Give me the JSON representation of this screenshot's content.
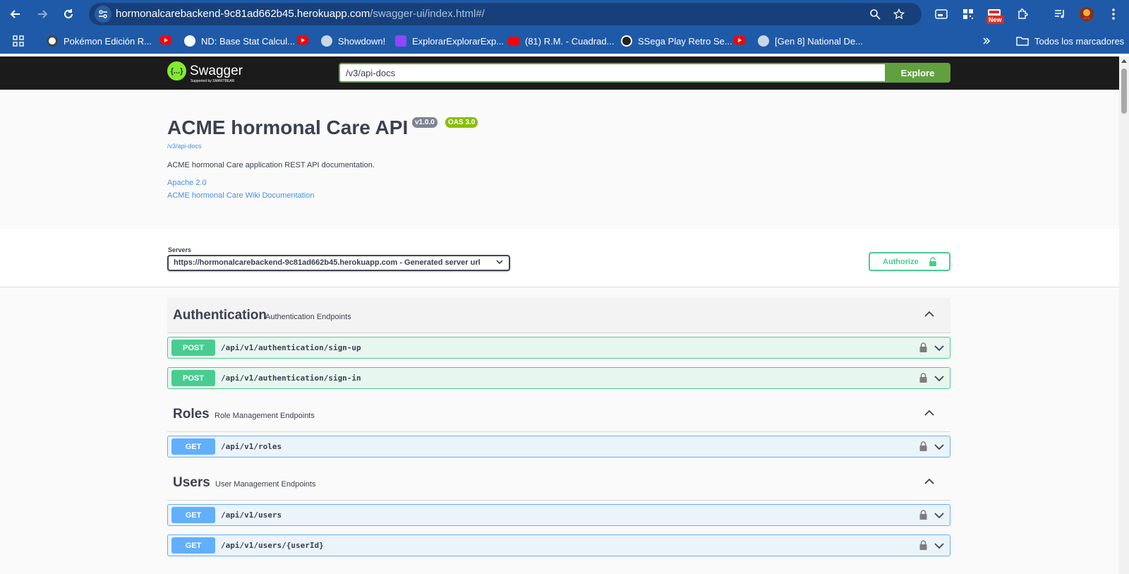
{
  "browser": {
    "url_host": "hormonalcarebackend-9c81ad662b45.herokuapp.com",
    "url_path": "/swagger-ui/index.html#/",
    "new_badge": "New"
  },
  "bookmarks": {
    "items": [
      {
        "label": "Pokémon Edición R...",
        "color": "#ffffff"
      },
      {
        "label": "ND: Base Stat Calcul...",
        "color": "#ffffff"
      },
      {
        "label": "Showdown!",
        "color": "#ffffff"
      },
      {
        "label": "ExplorarExplorarExp...",
        "color": "#9146ff"
      },
      {
        "label": "(81) R.M. - Cuadrad...",
        "color": "#ff0000"
      },
      {
        "label": "SSega Play Retro Se...",
        "color": "#222222"
      },
      {
        "label": "[Gen 8] National De...",
        "color": "#ffffff"
      }
    ],
    "all_bookmarks": "Todos los marcadores"
  },
  "topbar": {
    "logo_text": "Swagger",
    "logo_sub": "Supported by SMARTBEAR",
    "logo_symbol": "{...}",
    "spec_url": "/v3/api-docs",
    "explore_label": "Explore"
  },
  "info": {
    "title": "ACME hormonal Care API",
    "version": "v1.0.0",
    "oas": "OAS 3.0",
    "spec_link": "/v3/api-docs",
    "description": "ACME hormonal Care application REST API documentation.",
    "license": "Apache 2.0",
    "wiki": "ACME hormonal Care Wiki Documentation"
  },
  "servers": {
    "label": "Servers",
    "selected": "https://hormonalcarebackend-9c81ad662b45.herokuapp.com - Generated server url",
    "authorize_label": "Authorize"
  },
  "tags": [
    {
      "name": "Authentication",
      "description": "Authentication Endpoints",
      "operations": [
        {
          "method": "POST",
          "path": "/api/v1/authentication/sign-up"
        },
        {
          "method": "POST",
          "path": "/api/v1/authentication/sign-in"
        }
      ]
    },
    {
      "name": "Roles",
      "description": "Role Management Endpoints",
      "operations": [
        {
          "method": "GET",
          "path": "/api/v1/roles"
        }
      ]
    },
    {
      "name": "Users",
      "description": "User Management Endpoints",
      "operations": [
        {
          "method": "GET",
          "path": "/api/v1/users"
        },
        {
          "method": "GET",
          "path": "/api/v1/users/{userId}"
        }
      ]
    }
  ],
  "colors": {
    "post": "#49cc90",
    "get": "#61affe",
    "swagger_green": "#85ea2d",
    "explore_green": "#62a03f",
    "chrome_blue": "#1f5aa8"
  }
}
